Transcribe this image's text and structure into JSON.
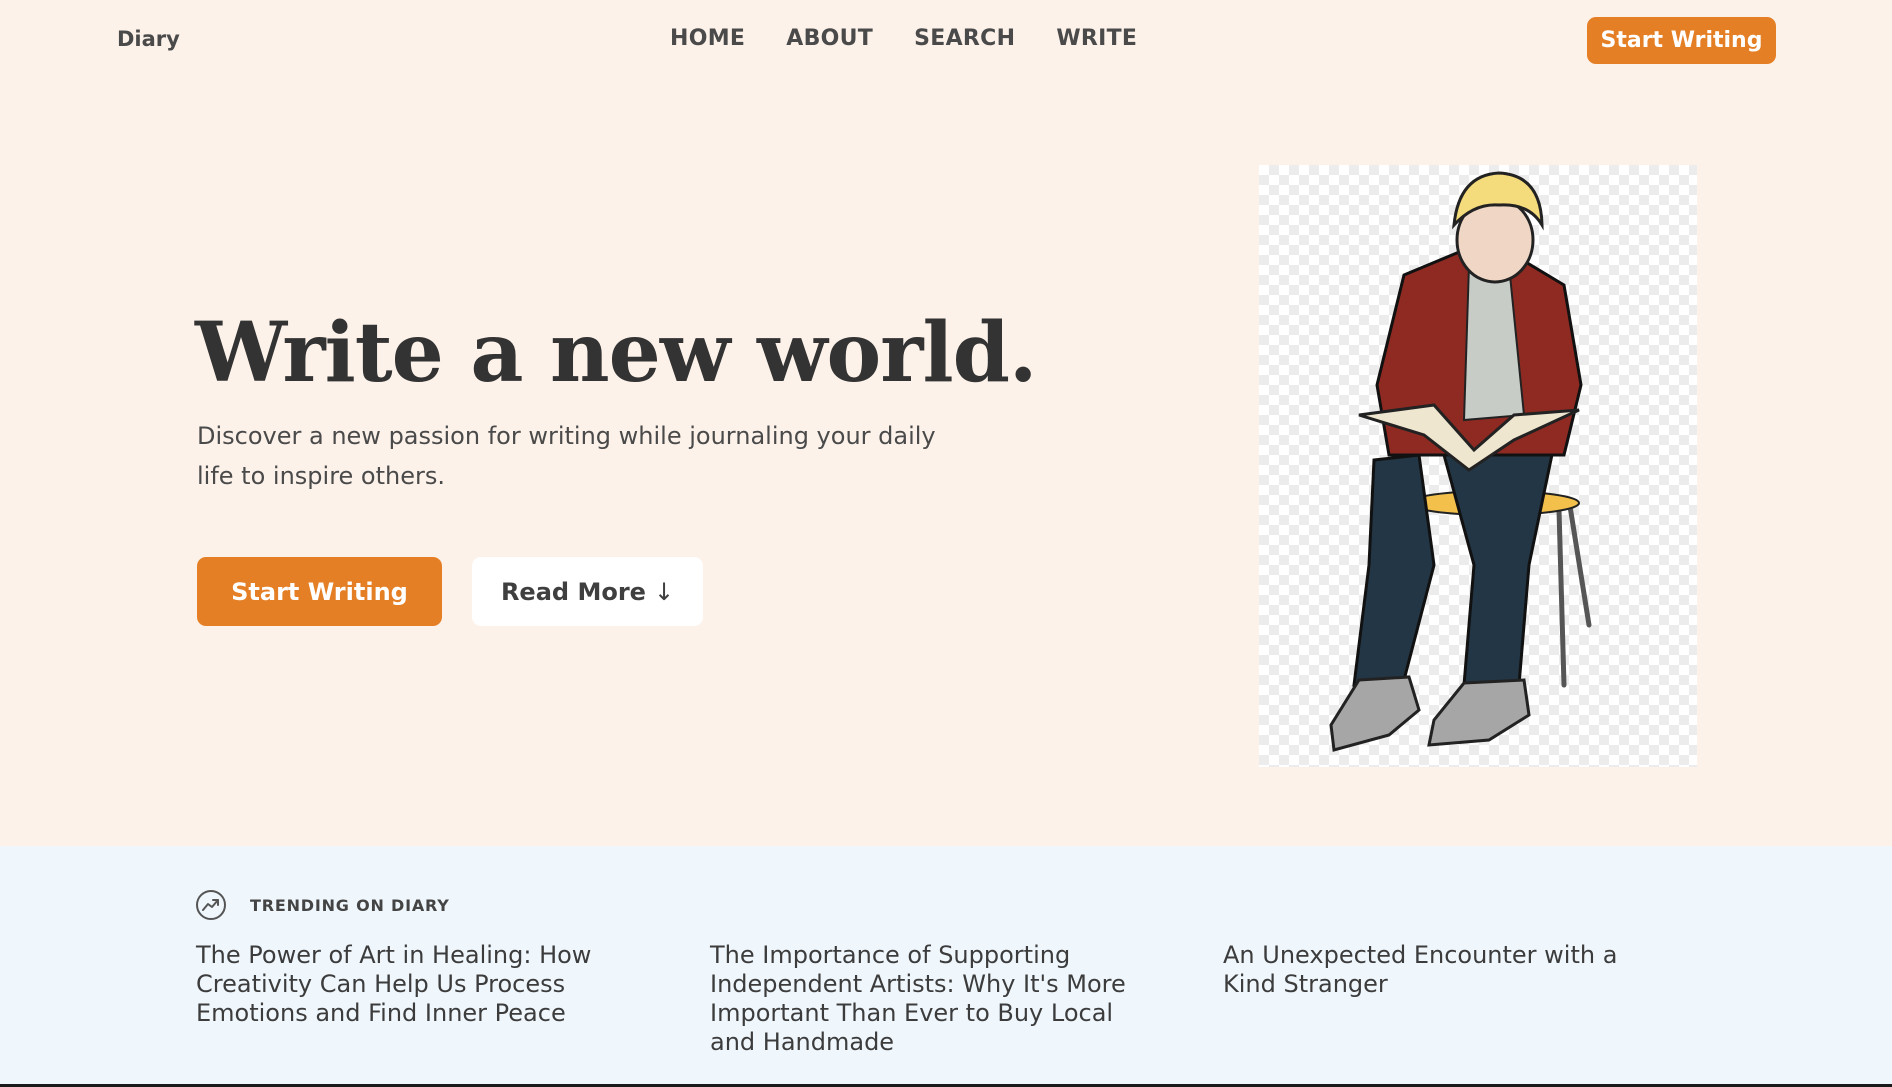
{
  "header": {
    "logo": "Diary",
    "nav": [
      "HOME",
      "ABOUT",
      "SEARCH",
      "WRITE"
    ],
    "cta": "Start Writing"
  },
  "hero": {
    "title": "Write a new world.",
    "subtitle": "Discover a new passion for writing while journaling your daily life to inspire others.",
    "primary_button": "Start Writing",
    "secondary_button": "Read More",
    "secondary_arrow": "↓",
    "illustration": "person-reading-book-on-chair"
  },
  "trending": {
    "label": "TRENDING ON DIARY",
    "icon": "trending-up-icon",
    "items": [
      "The Power of Art in Healing: How Creativity Can Help Us Process Emotions and Find Inner Peace",
      "The Importance of Supporting Independent Artists: Why It's More Important Than Ever to Buy Local and Handmade",
      "An Unexpected Encounter with a Kind Stranger"
    ]
  },
  "colors": {
    "accent": "#e57f25",
    "background": "#fcf2ea",
    "trending_background": "#eff7fd"
  }
}
